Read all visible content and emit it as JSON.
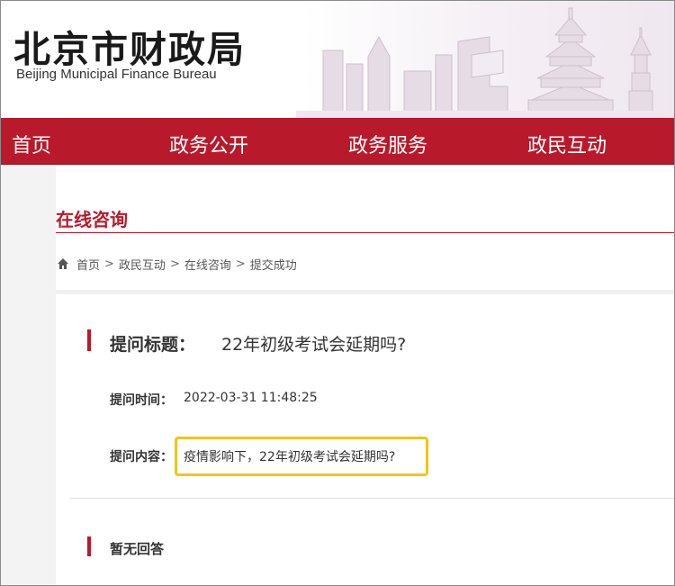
{
  "header": {
    "logo_cn": "北京市财政局",
    "logo_en": "Beijing Municipal Finance Bureau"
  },
  "nav": {
    "items": [
      {
        "label": "首页"
      },
      {
        "label": "政务公开"
      },
      {
        "label": "政务服务"
      },
      {
        "label": "政民互动"
      }
    ]
  },
  "section": {
    "title": "在线咨询"
  },
  "breadcrumb": {
    "items": [
      "首页",
      "政民互动",
      "在线咨询",
      "提交成功"
    ],
    "separator": ">"
  },
  "question": {
    "title_label": "提问标题：",
    "title": "22年初级考试会延期吗?",
    "time_label": "提问时间：",
    "time": "2022-03-31 11:48:25",
    "content_label": "提问内容：",
    "content": "疫情影响下，22年初级考试会延期吗?"
  },
  "reply": {
    "label": "暂无回答"
  },
  "colors": {
    "brand_red": "#b81a2b",
    "highlight": "#f5c31a"
  }
}
